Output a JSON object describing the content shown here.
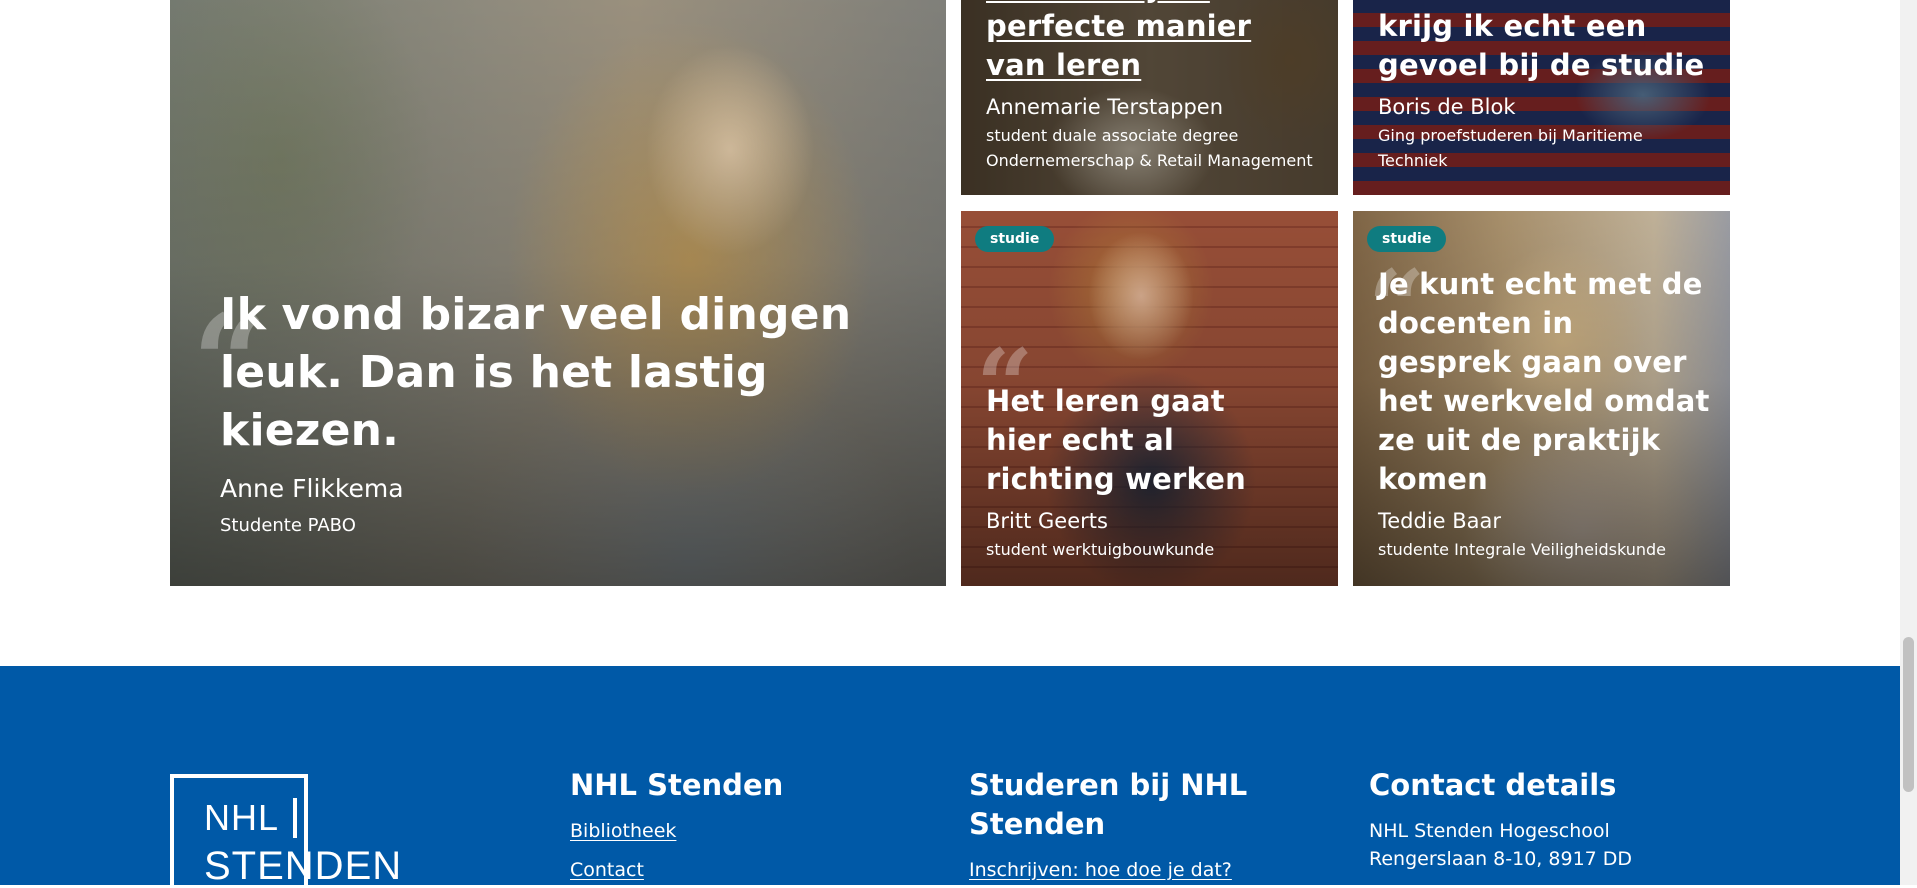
{
  "testimonials": [
    {
      "id": "anne",
      "quote": "Ik vond bizar veel dingen leuk. Dan is het lastig kiezen.",
      "name": "Anne Flikkema",
      "role": "Studente PABO"
    },
    {
      "id": "annemarie",
      "quote": "is voor mij dé perfecte manier van leren",
      "name": "Annemarie Terstappen",
      "role": "student duale associate degree Ondernemerschap & Retail Management"
    },
    {
      "id": "boris",
      "quote": "krijg ik echt een gevoel bij de studie",
      "name": "Boris de Blok",
      "role": "Ging proefstuderen bij Maritieme Techniek"
    },
    {
      "id": "britt",
      "badge": "studie",
      "quote": "Het leren gaat hier echt al richting werken",
      "name": "Britt Geerts",
      "role": "student werktuigbouwkunde"
    },
    {
      "id": "teddie",
      "badge": "studie",
      "quote": "Je kunt echt met de docenten in gesprek gaan over het werkveld omdat ze uit de praktijk komen",
      "name": "Teddie Baar",
      "role": "studente Integrale Veiligheidskunde"
    }
  ],
  "footer": {
    "logo": {
      "line1": "NHL",
      "line2": "STENDEN"
    },
    "col1": {
      "title": "NHL Stenden",
      "links": [
        "Bibliotheek",
        "Contact"
      ]
    },
    "col2": {
      "title": "Studeren bij NHL Stenden",
      "links": [
        "Inschrijven: hoe doe je dat?"
      ]
    },
    "col3": {
      "title": "Contact details",
      "lines": [
        "NHL Stenden Hogeschool",
        "Rengerslaan 8-10, 8917 DD"
      ]
    }
  },
  "colors": {
    "footer_bg": "#0059a7",
    "badge_bg": "#0f7c80"
  }
}
